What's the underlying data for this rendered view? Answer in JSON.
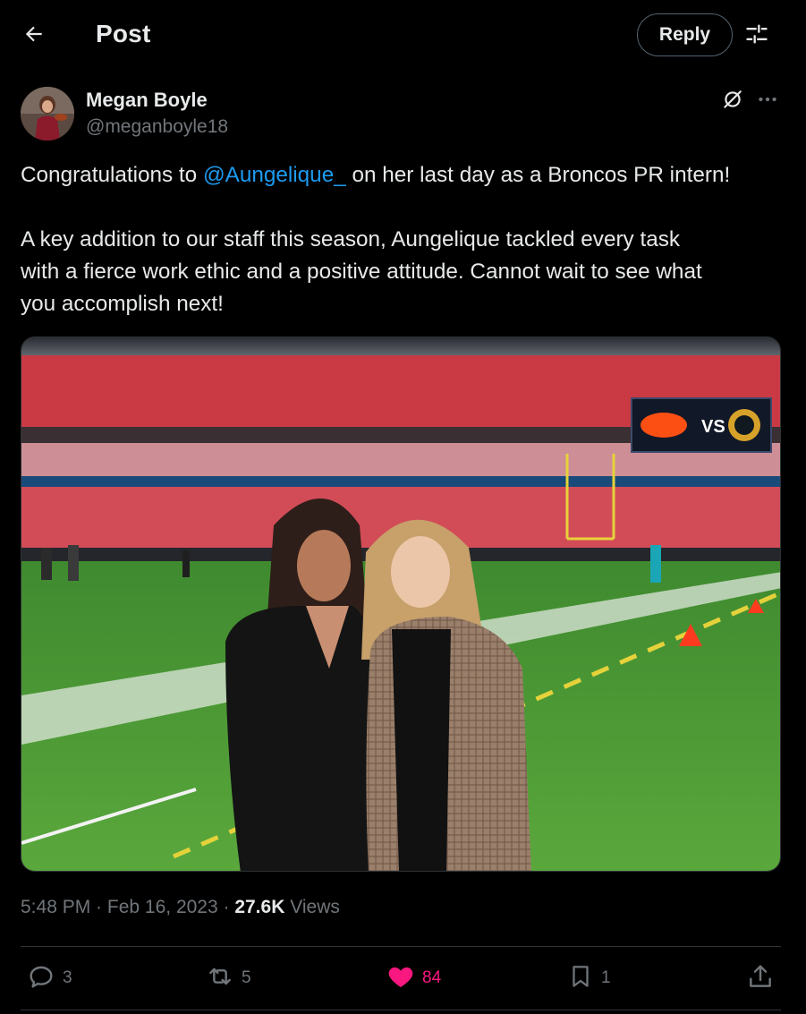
{
  "header": {
    "title": "Post",
    "reply_label": "Reply"
  },
  "author": {
    "name": "Megan Boyle",
    "handle": "@meganboyle18"
  },
  "tweet": {
    "line1_pre": "Congratulations to ",
    "mention": "@Aungelique_",
    "line1_post": " on her last day as a Broncos PR intern!",
    "line2": "A key addition to our staff this season, Aungelique tackled every task",
    "line3": "with a fierce work ethic and a positive attitude. Cannot wait to see what",
    "line4": "you accomplish next!"
  },
  "photo": {
    "scoreboard_text": "VS"
  },
  "meta": {
    "time": "5:48 PM",
    "date": "Feb 16, 2023",
    "views_count": "27.6K",
    "views_label": "Views"
  },
  "actions": {
    "replies": "3",
    "reposts": "5",
    "likes": "84",
    "bookmarks": "1"
  },
  "colors": {
    "background": "#000000",
    "text": "#e7e9ea",
    "secondary": "#71767b",
    "link": "#1d9bf0",
    "like": "#f91880",
    "border": "#2f3336"
  },
  "icons": {
    "back": "back-arrow-icon",
    "filter": "sliders-icon",
    "grok": "grok-icon",
    "more": "more-horizontal-icon",
    "reply": "reply-icon",
    "repost": "repost-icon",
    "like": "heart-filled-icon",
    "bookmark": "bookmark-icon",
    "share": "share-icon"
  }
}
